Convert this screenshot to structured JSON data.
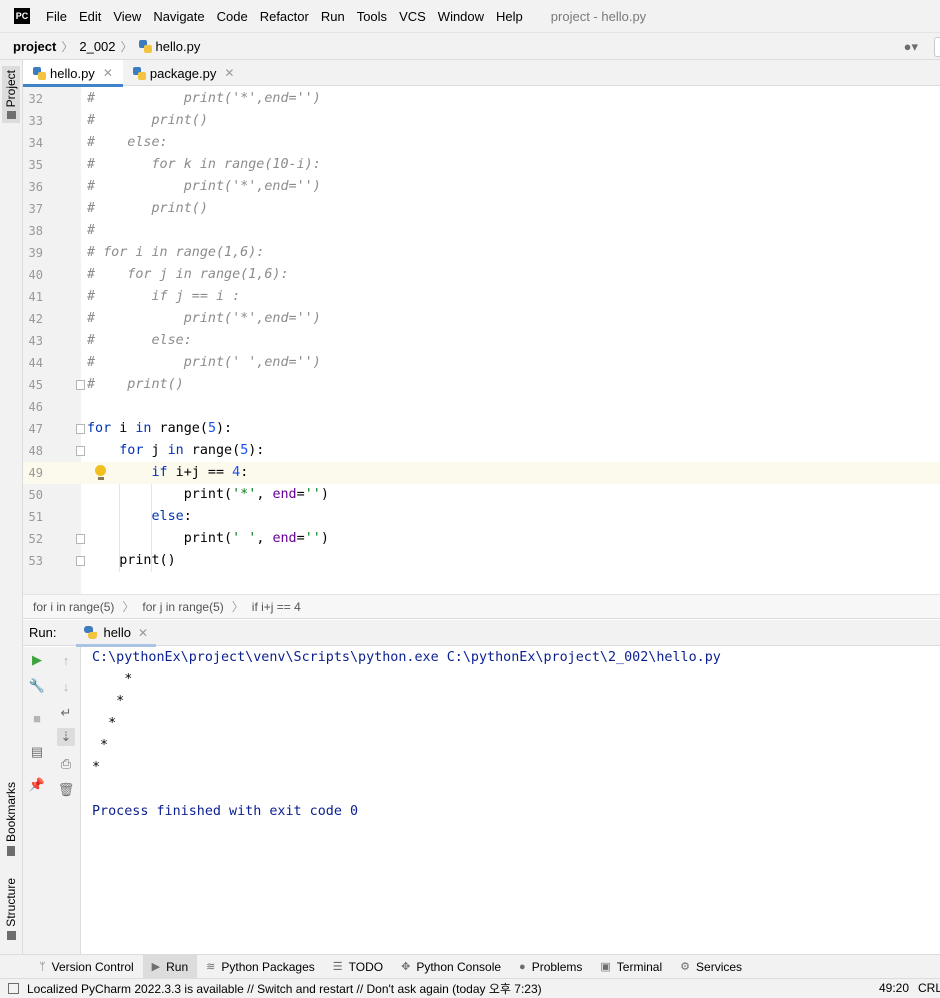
{
  "app": {
    "logo_text": "PC",
    "window_title": "project - hello.py",
    "menu": [
      "File",
      "Edit",
      "View",
      "Navigate",
      "Code",
      "Refactor",
      "Run",
      "Tools",
      "VCS",
      "Window",
      "Help"
    ]
  },
  "navbar": {
    "breadcrumbs": [
      "project",
      "2_002",
      "hello.py"
    ],
    "user_icon": "user-icon"
  },
  "left_stripe": {
    "tabs": [
      "Project",
      "Bookmarks",
      "Structure"
    ]
  },
  "editor_tabs": [
    {
      "label": "hello.py",
      "active": true
    },
    {
      "label": "package.py",
      "active": false
    }
  ],
  "editor": {
    "lines": [
      {
        "n": "32",
        "text": "#           print('*',end='')"
      },
      {
        "n": "33",
        "text": "#       print()"
      },
      {
        "n": "34",
        "text": "#    else:"
      },
      {
        "n": "35",
        "text": "#       for k in range(10-i):"
      },
      {
        "n": "36",
        "text": "#           print('*',end='')"
      },
      {
        "n": "37",
        "text": "#       print()"
      },
      {
        "n": "38",
        "text": "#"
      },
      {
        "n": "39",
        "text": "# for i in range(1,6):"
      },
      {
        "n": "40",
        "text": "#    for j in range(1,6):"
      },
      {
        "n": "41",
        "text": "#       if j == i :"
      },
      {
        "n": "42",
        "text": "#           print('*',end='')"
      },
      {
        "n": "43",
        "text": "#       else:"
      },
      {
        "n": "44",
        "text": "#           print(' ',end='')"
      },
      {
        "n": "45",
        "text": "#    print()"
      },
      {
        "n": "46",
        "text": ""
      },
      {
        "n": "47",
        "text": "for i in range(5):"
      },
      {
        "n": "48",
        "text": "    for j in range(5):"
      },
      {
        "n": "49",
        "text": "        if i+j == 4:"
      },
      {
        "n": "50",
        "text": "            print('*', end='')"
      },
      {
        "n": "51",
        "text": "        else:"
      },
      {
        "n": "52",
        "text": "            print(' ', end='')"
      },
      {
        "n": "53",
        "text": "    print()"
      }
    ]
  },
  "editor_breadcrumbs": [
    "for i in range(5)",
    "for j in range(5)",
    "if i+j == 4"
  ],
  "run": {
    "label": "Run:",
    "tab": "hello",
    "console": [
      {
        "text": "C:\\pythonEx\\project\\venv\\Scripts\\python.exe C:\\pythonEx\\project\\2_002\\hello.py",
        "type": "sys"
      },
      {
        "text": "    *",
        "type": "out"
      },
      {
        "text": "   *",
        "type": "out"
      },
      {
        "text": "  *",
        "type": "out"
      },
      {
        "text": " *",
        "type": "out"
      },
      {
        "text": "*",
        "type": "out"
      },
      {
        "text": "",
        "type": "out"
      },
      {
        "text": "Process finished with exit code 0",
        "type": "sys"
      }
    ]
  },
  "bottom_tools": [
    {
      "label": "Version Control",
      "icon": "branch-icon",
      "active": false
    },
    {
      "label": "Run",
      "icon": "run-icon",
      "active": true
    },
    {
      "label": "Python Packages",
      "icon": "layers-icon",
      "active": false
    },
    {
      "label": "TODO",
      "icon": "list-icon",
      "active": false
    },
    {
      "label": "Python Console",
      "icon": "python-console-icon",
      "active": false
    },
    {
      "label": "Problems",
      "icon": "problems-icon",
      "active": false
    },
    {
      "label": "Terminal",
      "icon": "terminal-icon",
      "active": false
    },
    {
      "label": "Services",
      "icon": "services-icon",
      "active": false
    }
  ],
  "status": {
    "message": "Localized PyCharm 2022.3.3 is available // Switch and restart // Don't ask again (today 오후 7:23)",
    "position": "49:20",
    "line_ending": "CRL"
  },
  "colors": {
    "keyword": "#0033b3",
    "number": "#1750eb",
    "string": "#067d17",
    "comment": "#8c8c8c",
    "kwarg": "#660099",
    "console_system": "#0a1f8f",
    "tab_underline": "#4083c9",
    "caret_row": "#fcfaed"
  }
}
